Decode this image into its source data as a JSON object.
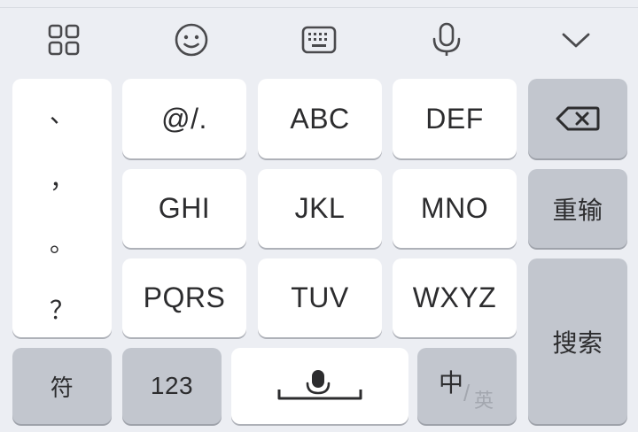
{
  "toolbar": {
    "icons": [
      "apps-grid-icon",
      "emoji-icon",
      "keyboard-icon",
      "microphone-icon",
      "collapse-chevron-icon"
    ]
  },
  "punctuation": [
    "、",
    "，",
    "。",
    "？"
  ],
  "keys": {
    "row1": [
      "@/.",
      "ABC",
      "DEF"
    ],
    "row2": [
      "GHI",
      "JKL",
      "MNO"
    ],
    "row3": [
      "PQRS",
      "TUV",
      "WXYZ"
    ]
  },
  "side": {
    "backspace_icon": "backspace-icon",
    "retype": "重输",
    "search": "搜索"
  },
  "bottom": {
    "symbols": "符",
    "numbers": "123",
    "space_icon": "microphone-space-icon",
    "lang_primary": "中",
    "lang_separator": "/",
    "lang_secondary": "英"
  },
  "colors": {
    "background": "#eceef3",
    "key": "#ffffff",
    "function_key": "#c2c6ce",
    "text": "#2c2c2e"
  }
}
